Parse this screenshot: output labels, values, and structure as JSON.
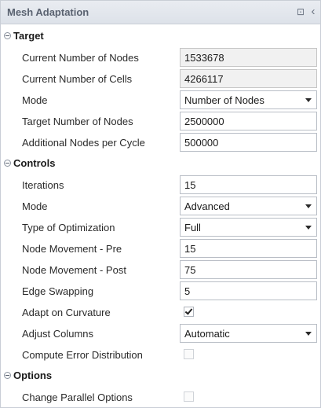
{
  "window": {
    "title": "Mesh Adaptation",
    "pin_icon": "pin-icon",
    "collapse_icon": "chevron-left-icon"
  },
  "sections": {
    "target": {
      "label": "Target",
      "current_nodes": {
        "label": "Current Number of Nodes",
        "value": "1533678"
      },
      "current_cells": {
        "label": "Current Number of Cells",
        "value": "4266117"
      },
      "mode": {
        "label": "Mode",
        "value": "Number of Nodes"
      },
      "target_nodes": {
        "label": "Target Number of Nodes",
        "value": "2500000"
      },
      "additional_nodes": {
        "label": "Additional Nodes per Cycle",
        "value": "500000"
      }
    },
    "controls": {
      "label": "Controls",
      "iterations": {
        "label": "Iterations",
        "value": "15"
      },
      "mode": {
        "label": "Mode",
        "value": "Advanced"
      },
      "optimization": {
        "label": "Type of Optimization",
        "value": "Full"
      },
      "node_move_pre": {
        "label": "Node Movement - Pre",
        "value": "15"
      },
      "node_move_post": {
        "label": "Node Movement - Post",
        "value": "75"
      },
      "edge_swapping": {
        "label": "Edge Swapping",
        "value": "5"
      },
      "adapt_curvature": {
        "label": "Adapt on Curvature",
        "checked": true
      },
      "adjust_columns": {
        "label": "Adjust Columns",
        "value": "Automatic"
      },
      "compute_error": {
        "label": "Compute Error Distribution",
        "checked": false
      }
    },
    "options": {
      "label": "Options",
      "parallel_options": {
        "label": "Change Parallel Options",
        "checked": false
      }
    }
  }
}
